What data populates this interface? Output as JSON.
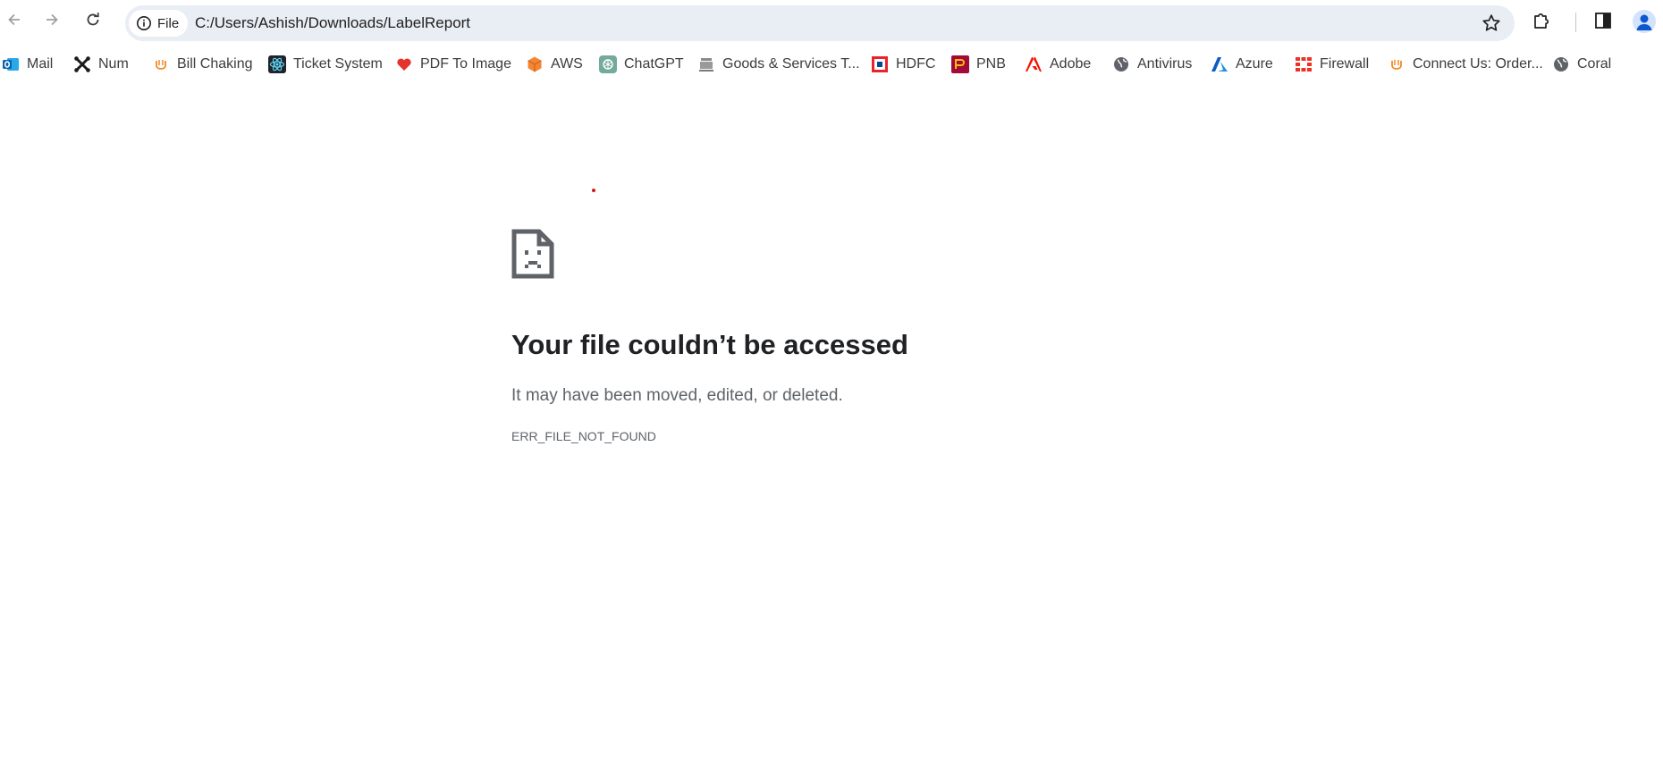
{
  "address_bar": {
    "chip_label": "File",
    "url": "C:/Users/Ashish/Downloads/LabelReport"
  },
  "bookmarks": [
    {
      "label": "Mail",
      "icon": "outlook-icon"
    },
    {
      "label": "Num",
      "icon": "joomla-icon"
    },
    {
      "label": "Bill Chaking",
      "icon": "orange-logo-icon"
    },
    {
      "label": "Ticket System",
      "icon": "react-icon"
    },
    {
      "label": "PDF To Image",
      "icon": "heart-icon"
    },
    {
      "label": "AWS",
      "icon": "aws-cube-icon"
    },
    {
      "label": "ChatGPT",
      "icon": "chatgpt-icon"
    },
    {
      "label": "Goods & Services T...",
      "icon": "emblem-icon"
    },
    {
      "label": "HDFC",
      "icon": "hdfc-icon"
    },
    {
      "label": "PNB",
      "icon": "pnb-icon"
    },
    {
      "label": "Adobe",
      "icon": "adobe-icon"
    },
    {
      "label": "Antivirus",
      "icon": "globe-icon"
    },
    {
      "label": "Azure",
      "icon": "azure-icon"
    },
    {
      "label": "Firewall",
      "icon": "fortinet-icon"
    },
    {
      "label": "Connect Us: Order...",
      "icon": "orange-logo-icon"
    },
    {
      "label": "Coral",
      "icon": "globe-icon"
    }
  ],
  "error": {
    "title": "Your file couldn’t be accessed",
    "subtitle": "It may have been moved, edited, or deleted.",
    "code": "ERR_FILE_NOT_FOUND"
  },
  "colors": {
    "omnibox_bg": "#e9edf4",
    "title": "#202124",
    "muted": "#5f6368"
  }
}
